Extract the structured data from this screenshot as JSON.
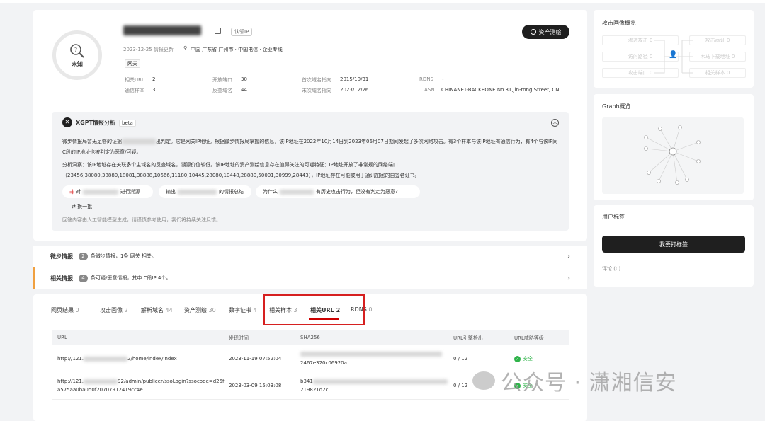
{
  "profile": {
    "verdict": "未知",
    "update_date": "2023-12-25 情报更新",
    "location": "中国 广东省 广州市 · 中国电信 · 企业专线",
    "recognize_tag": "认领IP",
    "label_tag": "网关",
    "asset_btn": "资产测绘",
    "stats": {
      "related_url_label": "相关URL",
      "related_url": "2",
      "open_ports_label": "开放端口",
      "open_ports": "30",
      "first_resolve_label": "首次域名指向",
      "first_resolve": "2015/10/31",
      "rdns_label": "RDNS",
      "rdns": "-",
      "comm_samples_label": "通信样本",
      "comm_samples": "3",
      "reverse_domains_label": "反查域名",
      "reverse_domains": "44",
      "last_resolve_label": "末次域名指向",
      "last_resolve": "2023/12/26",
      "asn_label": "ASN",
      "asn": "CHINANET-BACKBONE No.31,Jin-rong Street, CN"
    }
  },
  "xgpt": {
    "title": "XGPT情报分析",
    "beta": "beta",
    "para1_a": "微步情报局暂无足够的证据",
    "para1_b": "出判定。它是网关IP地址。根据微步情报局掌握的信息，该IP地址在2022年10月14日到2023年06月07日期间发起了多次网络攻击。有3个样本与该IP地址有通信行为，有4个与该IP同C段的IP地址也被判定为恶意/可疑。",
    "para2": "分析洞察：该IP地址存在关联多个主域名的反查域名，溯源价值较低。该IP地址的资产测绘信息存在值得关注的可疑特征：IP地址开放了非常规的网络端口（23456,38080,38880,18081,38888,10666,11180,10445,28080,10448,28880,50001,30999,28443），IP地址存在可能被用于通讯加密的自签名证书。",
    "suggestion1_a": "对",
    "suggestion1_b": "进行溯源",
    "suggestion2_a": "输出",
    "suggestion2_b": "的情报总结",
    "suggestion3_a": "为什么",
    "suggestion3_b": "有历史攻击行为，但没有判定为恶意?",
    "refresh": "换一批",
    "disclaimer": "回答内容由人工智能模型生成，请谨慎参考使用，我们将持续关注反馈。"
  },
  "weibu_intel": {
    "label": "微步情报",
    "count": "2",
    "desc": "条微步情报，1条 网关 相关。"
  },
  "related_intel": {
    "label": "相关情报",
    "count": "4",
    "desc": "条可疑/恶意情报，其中 C段IP 4个。"
  },
  "tabs": [
    {
      "name": "网页结果",
      "count": "0"
    },
    {
      "name": "攻击画像",
      "count": "2"
    },
    {
      "name": "解析域名",
      "count": "44"
    },
    {
      "name": "资产测绘",
      "count": "30"
    },
    {
      "name": "数字证书",
      "count": "4"
    },
    {
      "name": "相关样本",
      "count": "3"
    },
    {
      "name": "相关URL",
      "count": "2"
    },
    {
      "name": "RDNS",
      "count": "0"
    }
  ],
  "table": {
    "headers": [
      "URL",
      "发现时间",
      "SHA256",
      "URL引擎检出",
      "URL威胁等级"
    ],
    "rows": [
      {
        "url_a": "http://121.",
        "url_b": "2/home/index/index",
        "url_c": "",
        "time": "2023-11-19 07:52:04",
        "sha_a": "2467e320c06920a",
        "detect": "0 / 12",
        "level": "安全"
      },
      {
        "url_a": "http://121.",
        "url_b": "92/admin/publicer/ssoLogin?ssocode=d25f",
        "url_c": "a575aa0ba0d0f20707912419cc4e",
        "time": "2023-03-09 15:03:08",
        "sha_a": "b341",
        "sha_b": "219821d2c",
        "detect": "0 / 12",
        "level": "安全"
      }
    ]
  },
  "sidebar": {
    "attack_title": "攻击画像概览",
    "attack_left": [
      "渗透攻击 0",
      "访问路径 0",
      "攻击端口 0"
    ],
    "attack_right": [
      "攻击画证 0",
      "木马下载地址 0",
      "相关样本 0"
    ],
    "graph_title": "Graph概览",
    "user_tags_title": "用户标签",
    "tag_btn": "我要打标签",
    "comments": "评论 (0)"
  },
  "watermark": "公众号 · 潇湘信安"
}
